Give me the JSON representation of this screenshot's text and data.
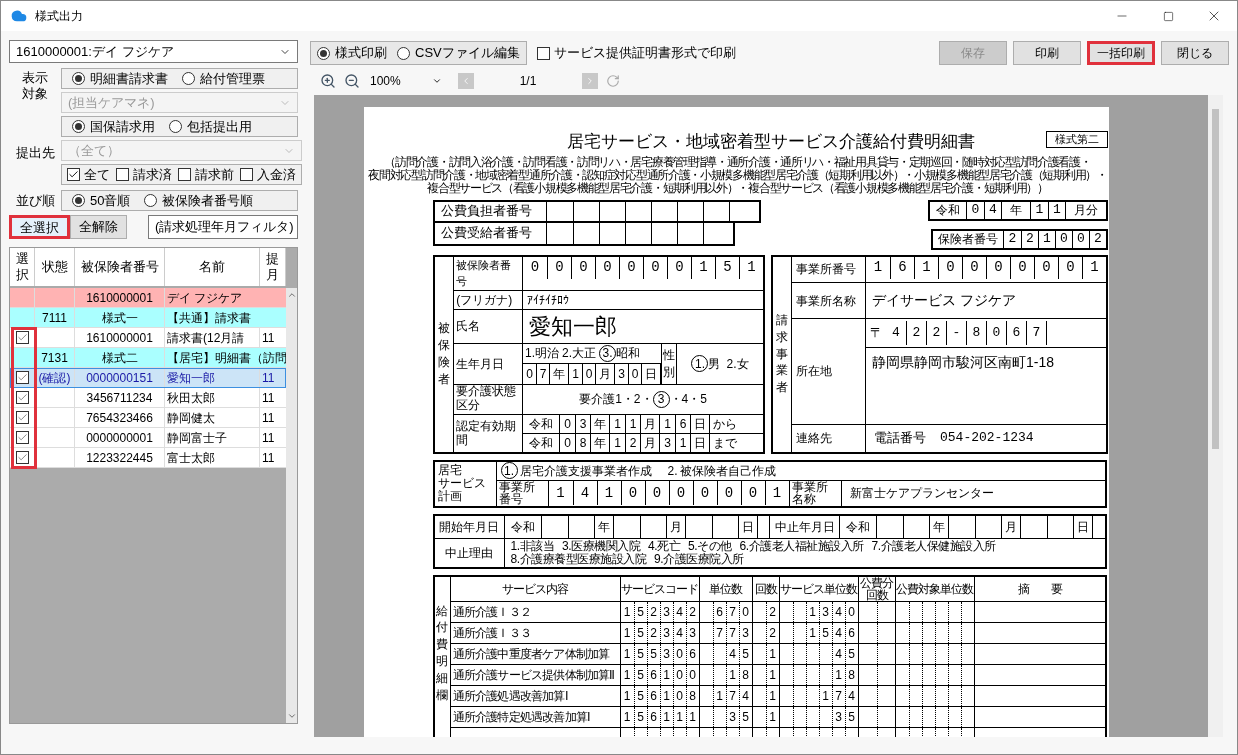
{
  "window": {
    "title": "様式出力"
  },
  "filters": {
    "office": "1610000001:デイ フジケア",
    "display_target": {
      "label": "表示対象",
      "options": [
        {
          "label": "明細書請求書",
          "selected": true
        },
        {
          "label": "給付管理票",
          "selected": false
        }
      ]
    },
    "care_manager": {
      "value": "(担当ケアマネ)",
      "disabled": true
    },
    "claim_type": [
      {
        "label": "国保請求用",
        "selected": true
      },
      {
        "label": "包括提出用",
        "selected": false
      }
    ],
    "destination": {
      "label": "提出先",
      "value": "（全て）",
      "disabled": true
    },
    "status_filters": [
      {
        "label": "全て",
        "checked": true
      },
      {
        "label": "請求済",
        "checked": false
      },
      {
        "label": "請求前",
        "checked": false
      },
      {
        "label": "入金済",
        "checked": false
      }
    ],
    "sort": {
      "label": "並び順",
      "options": [
        {
          "label": "50音順",
          "selected": true
        },
        {
          "label": "被保険者番号順",
          "selected": false
        }
      ]
    },
    "buttons": [
      {
        "label": "全選択",
        "highlighted": true
      },
      {
        "label": "全解除",
        "highlighted": false
      }
    ],
    "month_filter": "(請求処理年月フィルタ)"
  },
  "claims_table": {
    "checkbox_column_highlighted": true,
    "columns": [
      "選択",
      "状態",
      "被保険者番号",
      "名前",
      "提月"
    ],
    "rows": [
      {
        "kind": "office",
        "selected": false,
        "number": "1610000001",
        "name": "デイ フジケア"
      },
      {
        "kind": "form",
        "selected": false,
        "status": "7111",
        "number": "様式一",
        "name": "【共通】請求書"
      },
      {
        "kind": "item",
        "selected": false,
        "checked": true,
        "number": "1610000001",
        "name": "請求書(12月請",
        "month": "11"
      },
      {
        "kind": "form",
        "selected": false,
        "status": "7131",
        "number": "様式二",
        "name": "【居宅】明細書（訪問"
      },
      {
        "kind": "item",
        "selected": true,
        "checked": true,
        "status": "(確認)",
        "number": "0000000151",
        "name": "愛知一郎",
        "month": "11"
      },
      {
        "kind": "item",
        "selected": false,
        "checked": true,
        "number": "3456711234",
        "name": "秋田太郎",
        "month": "11"
      },
      {
        "kind": "item",
        "selected": false,
        "checked": true,
        "number": "7654323466",
        "name": "静岡健太",
        "month": "11"
      },
      {
        "kind": "item",
        "selected": false,
        "checked": true,
        "number": "0000000001",
        "name": "静岡富士子",
        "month": "11"
      },
      {
        "kind": "item",
        "selected": false,
        "checked": true,
        "number": "1223322445",
        "name": "富士太郎",
        "month": "11"
      }
    ]
  },
  "toolbar": {
    "print_mode": [
      {
        "label": "様式印刷",
        "selected": true
      },
      {
        "label": "CSVファイル編集",
        "selected": false
      }
    ],
    "certificate_option": {
      "label": "サービス提供証明書形式で印刷",
      "checked": false
    },
    "actions": [
      {
        "label": "保存",
        "disabled": true,
        "highlighted": false
      },
      {
        "label": "印刷",
        "disabled": false,
        "highlighted": false
      },
      {
        "label": "一括印刷",
        "disabled": false,
        "highlighted": true
      },
      {
        "label": "閉じる",
        "disabled": false,
        "highlighted": false
      }
    ]
  },
  "viewer": {
    "zoom": "100%",
    "page": "1/1"
  },
  "document": {
    "title": "居宅サービス・地域密着型サービス介護給付費明細書",
    "form_no": "様式第二",
    "scope_lines": [
      "（訪問介護・訪問入浴介護・訪問看護・訪問リハ・居宅療養管理指導・通所介護・通所リハ・福祉用具貸与・定期巡回・随時対応型訪問介護看護・",
      "夜間対応型訪問介護・地域密着型通所介護・認知症対応型通所介護・小規模多機能型居宅介護（短期利用以外）・小規模多機能型居宅介護（短期利用）・",
      "複合型サービス（看護小規模多機能型居宅介護・短期利用以外）・複合型サービス（看護小規模多機能型居宅介護・短期利用））"
    ],
    "public_payer_label": "公費負担者番号",
    "public_recipient_label": "公費受給者番号",
    "claim_month": {
      "era": "令和",
      "parts": [
        {
          "digits": [
            "0",
            "4"
          ],
          "unit": "年"
        },
        {
          "digits": [
            "1",
            "1"
          ],
          "unit": "月分"
        }
      ]
    },
    "insurer": {
      "label": "保険者番号",
      "digits": [
        "2",
        "2",
        "1",
        "0",
        "0",
        "2"
      ]
    },
    "insured": {
      "side_label": "被保険者",
      "number_label": "被保険者番号",
      "number": [
        "0",
        "0",
        "0",
        "0",
        "0",
        "0",
        "0",
        "1",
        "5",
        "1"
      ],
      "kana_label": "(フリガナ)",
      "kana": "ｱｲﾁｲﾁﾛｳ",
      "name_label": "氏名",
      "name": "愛知一郎",
      "birth_label": "生年月日",
      "eras": [
        {
          "number": "1.",
          "name": "明治",
          "selected": false
        },
        {
          "number": "2.",
          "name": "大正",
          "selected": false
        },
        {
          "number": "3.",
          "name": "昭和",
          "selected": true
        }
      ],
      "birth": {
        "parts": [
          {
            "digits": [
              "0",
              "7"
            ],
            "unit": "年"
          },
          {
            "digits": [
              "1",
              "0"
            ],
            "unit": "月"
          },
          {
            "digits": [
              "3",
              "0"
            ],
            "unit": "日"
          }
        ]
      },
      "sex_label": "性別",
      "sexes": [
        {
          "number": "1.",
          "name": "男",
          "selected": true
        },
        {
          "number": "2.",
          "name": "女",
          "selected": false
        }
      ],
      "care_level_label": "要介護状態区分",
      "care_level_prefix": "要介護",
      "care_level_separator": "・",
      "care_levels": [
        {
          "label": "1",
          "selected": false
        },
        {
          "label": "2",
          "selected": false
        },
        {
          "label": "3",
          "selected": true
        },
        {
          "label": "4",
          "selected": false
        },
        {
          "label": "5",
          "selected": false
        }
      ],
      "validity_label": "認定有効期間",
      "validity": [
        {
          "era": "令和",
          "parts": [
            {
              "digits": [
                "0",
                "3"
              ],
              "unit": "年"
            },
            {
              "digits": [
                "1",
                "1"
              ],
              "unit": "月"
            },
            {
              "digits": [
                "1",
                "6"
              ],
              "unit": "日"
            }
          ],
          "suffix": "から"
        },
        {
          "era": "令和",
          "parts": [
            {
              "digits": [
                "0",
                "8"
              ],
              "unit": "年"
            },
            {
              "digits": [
                "1",
                "2"
              ],
              "unit": "月"
            },
            {
              "digits": [
                "3",
                "1"
              ],
              "unit": "日"
            }
          ],
          "suffix": "まで"
        }
      ]
    },
    "provider": {
      "side_label": "請求事業者",
      "number_label": "事業所番号",
      "number": [
        "1",
        "6",
        "1",
        "0",
        "0",
        "0",
        "0",
        "0",
        "0",
        "1"
      ],
      "name_label": "事業所名称",
      "name": "デイサービス フジケア",
      "address_label": "所在地",
      "postal_mark": "〒",
      "postal": [
        "4",
        "2",
        "2",
        "-",
        "8",
        "0",
        "6",
        "7"
      ],
      "address": "静岡県静岡市駿河区南町1-18",
      "contact_label": "連絡先",
      "phone_label": "電話番号",
      "phone": "054-202-1234"
    },
    "care_plan": {
      "label_lines": [
        "居宅",
        "サービス",
        "計画"
      ],
      "options": [
        {
          "number": "1.",
          "text": "居宅介護支援事業者作成",
          "selected": true
        },
        {
          "number": "2.",
          "text": "被保険者自己作成",
          "selected": false
        }
      ],
      "office_number_label": "事業所番号",
      "office_number": [
        "1",
        "4",
        "1",
        "0",
        "0",
        "0",
        "0",
        "0",
        "0",
        "1"
      ],
      "office_name_label": "事業所名称",
      "office_name": "新富士ケアプランセンター"
    },
    "period": {
      "start_label": "開始年月日",
      "start": {
        "era": "令和",
        "parts": [
          {
            "unit": "年"
          },
          {
            "unit": "月"
          },
          {
            "unit": "日"
          }
        ]
      },
      "stop_label": "中止年月日",
      "stop": {
        "era": "令和",
        "parts": [
          {
            "unit": "年"
          },
          {
            "unit": "月"
          },
          {
            "unit": "日"
          }
        ]
      },
      "reason_label": "中止理由",
      "reasons": [
        "1.非該当",
        "3.医療機関入院",
        "4.死亡",
        "5.その他",
        "6.介護老人福祉施設入所",
        "7.介護老人保健施設入所",
        "8.介護療養型医療施設入院",
        "9.介護医療院入所"
      ]
    },
    "services": {
      "side_label": "給付費明細欄",
      "columns": [
        "サービス内容",
        "サービスコード",
        "単位数",
        "回数",
        "サービス単位数",
        "公費分回数",
        "公費対象単位数",
        "摘　　要"
      ],
      "rows": [
        {
          "name": "通所介護Ｉ３２",
          "code": [
            "1",
            "5",
            "2",
            "3",
            "4",
            "2"
          ],
          "units": [
            "6",
            "7",
            "0"
          ],
          "count": [
            "2"
          ],
          "service_units": [
            "1",
            "3",
            "4",
            "0"
          ]
        },
        {
          "name": "通所介護Ｉ３３",
          "code": [
            "1",
            "5",
            "2",
            "3",
            "4",
            "3"
          ],
          "units": [
            "7",
            "7",
            "3"
          ],
          "count": [
            "2"
          ],
          "service_units": [
            "1",
            "5",
            "4",
            "6"
          ]
        },
        {
          "name": "通所介護中重度者ケア体制加算",
          "code": [
            "1",
            "5",
            "5",
            "3",
            "0",
            "6"
          ],
          "units": [
            "4",
            "5"
          ],
          "count": [
            "1"
          ],
          "service_units": [
            "4",
            "5"
          ]
        },
        {
          "name": "通所介護サービス提供体制加算Ⅱ",
          "code": [
            "1",
            "5",
            "6",
            "1",
            "0",
            "0"
          ],
          "units": [
            "1",
            "8"
          ],
          "count": [
            "1"
          ],
          "service_units": [
            "1",
            "8"
          ]
        },
        {
          "name": "通所介護処遇改善加算Ⅰ",
          "code": [
            "1",
            "5",
            "6",
            "1",
            "0",
            "8"
          ],
          "units": [
            "1",
            "7",
            "4"
          ],
          "count": [
            "1"
          ],
          "service_units": [
            "1",
            "7",
            "4"
          ]
        },
        {
          "name": "通所介護特定処遇改善加算Ⅰ",
          "code": [
            "1",
            "5",
            "6",
            "1",
            "1",
            "1"
          ],
          "units": [
            "3",
            "5"
          ],
          "count": [
            "1"
          ],
          "service_units": [
            "3",
            "5"
          ]
        }
      ]
    }
  }
}
